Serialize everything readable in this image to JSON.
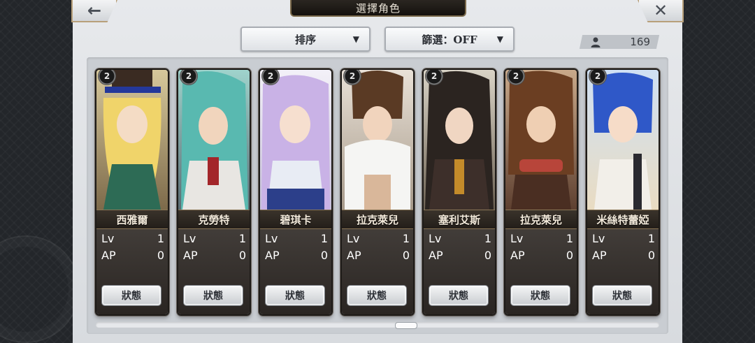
{
  "header": {
    "title": "選擇角色",
    "back_icon": "arrow-left-icon",
    "close_icon": "close-icon"
  },
  "toolbar": {
    "sort_label": "排序",
    "filter_label": "篩選：OFF",
    "dropdown_arrow": "▼"
  },
  "counter": {
    "icon": "person-icon",
    "value": "169"
  },
  "stat_labels": {
    "lv": "Lv",
    "ap": "AP"
  },
  "characters": [
    {
      "name": "西雅爾",
      "lv": "1",
      "ap": "0",
      "status": "狀態",
      "badge": "2"
    },
    {
      "name": "克勞特",
      "lv": "1",
      "ap": "0",
      "status": "狀態",
      "badge": "2"
    },
    {
      "name": "碧琪卡",
      "lv": "1",
      "ap": "0",
      "status": "狀態",
      "badge": "2"
    },
    {
      "name": "拉克萊兒",
      "lv": "1",
      "ap": "0",
      "status": "狀態",
      "badge": "2"
    },
    {
      "name": "塞利艾斯",
      "lv": "1",
      "ap": "0",
      "status": "狀態",
      "badge": "2"
    },
    {
      "name": "拉克萊兒",
      "lv": "1",
      "ap": "0",
      "status": "狀態",
      "badge": "2"
    },
    {
      "name": "米絲特蕾婭",
      "lv": "1",
      "ap": "0",
      "status": "狀態",
      "badge": "2"
    }
  ],
  "colors": {
    "accent_gold": "#b8a07a",
    "card_dark": "#2a2522",
    "panel_bg": "#e7e9ec"
  }
}
